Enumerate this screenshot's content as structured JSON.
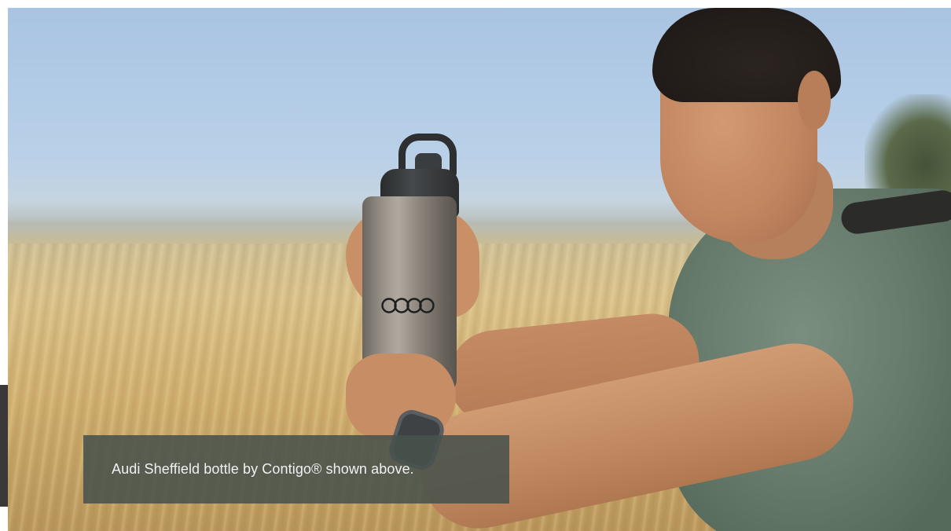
{
  "hero": {
    "caption": "Audi Sheffield bottle by Contigo® shown above.",
    "logo_icon": "audi-rings-logo",
    "colors": {
      "caption_background": "#48524c",
      "caption_text": "#f1f1f1"
    }
  }
}
